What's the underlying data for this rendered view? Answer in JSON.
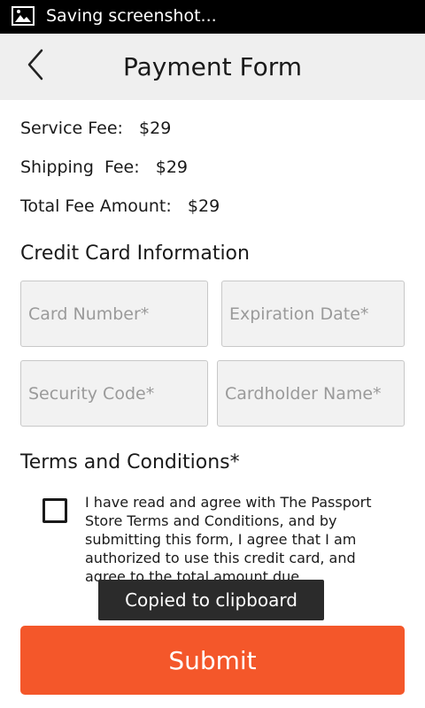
{
  "status_bar": {
    "icon": "image-icon",
    "text": "Saving screenshot..."
  },
  "app_bar": {
    "back_icon": "chevron-left-icon",
    "title": "Payment Form"
  },
  "fees": {
    "service_fee": "Service Fee:   $29",
    "shipping_fee": "Shipping  Fee:   $29",
    "total_fee": "Total Fee Amount:   $29"
  },
  "credit_card": {
    "heading": "Credit Card Information",
    "card_number_placeholder": "Card Number*",
    "expiration_placeholder": "Expiration Date*",
    "security_code_placeholder": "Security Code*",
    "cardholder_placeholder": "Cardholder Name*"
  },
  "terms": {
    "heading": "Terms and Conditions*",
    "text": "I have read and agree with The Passport Store Terms and Conditions, and by submitting this form, I agree that I am authorized to use this credit card, and agree to the total amount due",
    "checked": false
  },
  "toast": {
    "text": "Copied to clipboard"
  },
  "submit": {
    "label": "Submit"
  },
  "colors": {
    "accent": "#f4572a",
    "app_bar_bg": "#efefef",
    "status_bar_bg": "#000000",
    "toast_bg": "#2b2b2b",
    "field_bg": "#f2f2f2"
  }
}
